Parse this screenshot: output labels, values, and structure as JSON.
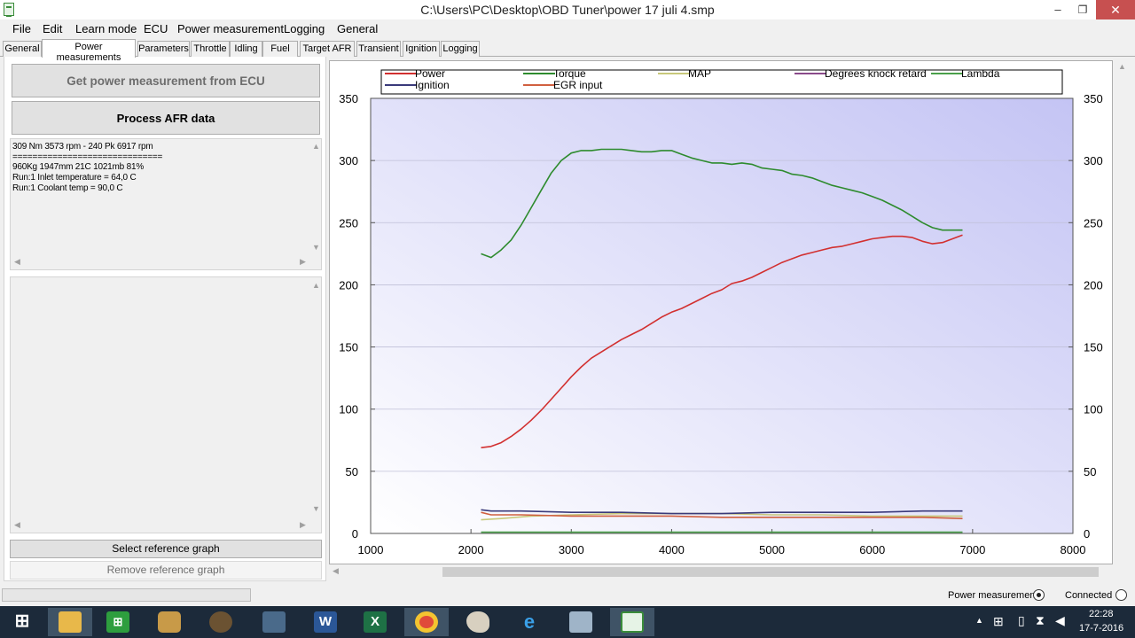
{
  "window": {
    "title": "C:\\Users\\PC\\Desktop\\OBD Tuner\\power 17 juli 4.smp",
    "minimize": "–",
    "maximize": "❐",
    "close": "✕"
  },
  "menu": [
    "File",
    "Edit",
    "Learn mode",
    "ECU",
    "Power measurement",
    "Logging",
    "General"
  ],
  "tabs": [
    "General",
    "Power measurements",
    "Parameters",
    "Throttle",
    "Idling",
    "Fuel",
    "Target AFR",
    "Transient",
    "Ignition",
    "Logging"
  ],
  "active_tab": "Power measurements",
  "left": {
    "get_button": "Get power measurement from ECU",
    "process_button": "Process AFR data",
    "info_lines": [
      "309 Nm 3573 rpm - 240 Pk 6917 rpm",
      "==============================",
      "960Kg 1947mm 21C 1021mb 81%",
      "Run:1 Inlet temperature = 64,0 C",
      "Run:1 Coolant temp = 90,0 C"
    ],
    "select_ref_button": "Select reference graph",
    "remove_ref_button": "Remove reference graph"
  },
  "chart_data": {
    "type": "line",
    "legend": [
      {
        "name": "Power",
        "color": "#d23030"
      },
      {
        "name": "Torque",
        "color": "#2e8b2e"
      },
      {
        "name": "MAP",
        "color": "#c8c87a"
      },
      {
        "name": "Degrees knock retard",
        "color": "#8a4a8a"
      },
      {
        "name": "Lambda",
        "color": "#4aa04a"
      },
      {
        "name": "Ignition",
        "color": "#3a3a7a"
      },
      {
        "name": "EGR input",
        "color": "#d06040"
      }
    ],
    "xlim": [
      1000,
      8000
    ],
    "ylim": [
      0,
      350
    ],
    "xticks": [
      "1000",
      "2000",
      "3000",
      "4000",
      "5000",
      "6000",
      "7000",
      "8000"
    ],
    "yticks": [
      "0",
      "50",
      "100",
      "150",
      "200",
      "250",
      "300",
      "350"
    ],
    "series": [
      {
        "name": "Power",
        "color": "#d23030",
        "x": [
          2100,
          2200,
          2300,
          2400,
          2500,
          2600,
          2700,
          2800,
          2900,
          3000,
          3100,
          3200,
          3300,
          3400,
          3500,
          3600,
          3700,
          3800,
          3900,
          4000,
          4100,
          4200,
          4300,
          4400,
          4500,
          4600,
          4700,
          4800,
          4900,
          5000,
          5100,
          5200,
          5300,
          5400,
          5500,
          5600,
          5700,
          5800,
          5900,
          6000,
          6100,
          6200,
          6300,
          6400,
          6500,
          6600,
          6700,
          6800,
          6900
        ],
        "y": [
          69,
          70,
          73,
          78,
          84,
          91,
          99,
          108,
          117,
          126,
          134,
          141,
          146,
          151,
          156,
          160,
          164,
          169,
          174,
          178,
          181,
          185,
          189,
          193,
          196,
          201,
          203,
          206,
          210,
          214,
          218,
          221,
          224,
          226,
          228,
          230,
          231,
          233,
          235,
          237,
          238,
          239,
          239,
          238,
          235,
          233,
          234,
          237,
          240
        ]
      },
      {
        "name": "Torque",
        "color": "#2e8b2e",
        "x": [
          2100,
          2200,
          2300,
          2400,
          2500,
          2600,
          2700,
          2800,
          2900,
          3000,
          3100,
          3200,
          3300,
          3400,
          3500,
          3600,
          3700,
          3800,
          3900,
          4000,
          4100,
          4200,
          4300,
          4400,
          4500,
          4600,
          4700,
          4800,
          4900,
          5000,
          5100,
          5200,
          5300,
          5400,
          5500,
          5600,
          5700,
          5800,
          5900,
          6000,
          6100,
          6200,
          6300,
          6400,
          6500,
          6600,
          6700,
          6800,
          6900
        ],
        "y": [
          225,
          222,
          228,
          236,
          248,
          262,
          276,
          290,
          300,
          306,
          308,
          308,
          309,
          309,
          309,
          308,
          307,
          307,
          308,
          308,
          305,
          302,
          300,
          298,
          298,
          297,
          298,
          297,
          294,
          293,
          292,
          289,
          288,
          286,
          283,
          280,
          278,
          276,
          274,
          271,
          268,
          264,
          260,
          255,
          250,
          246,
          244,
          244,
          244
        ]
      },
      {
        "name": "MAP",
        "color": "#c8c87a",
        "x": [
          2100,
          2300,
          2600,
          3000,
          3500,
          4000,
          4500,
          5000,
          5500,
          6000,
          6500,
          6900
        ],
        "y": [
          11,
          12,
          14,
          15,
          16,
          16,
          16,
          15,
          15,
          14,
          14,
          14
        ]
      },
      {
        "name": "Ignition",
        "color": "#3a3a7a",
        "x": [
          2100,
          2200,
          2500,
          3000,
          3500,
          4000,
          4500,
          5000,
          5500,
          6000,
          6500,
          6900
        ],
        "y": [
          19,
          18,
          18,
          17,
          17,
          16,
          16,
          17,
          17,
          17,
          18,
          18
        ]
      },
      {
        "name": "EGR input",
        "color": "#d06040",
        "x": [
          2100,
          2200,
          2500,
          3000,
          3500,
          4000,
          4500,
          5000,
          5500,
          6000,
          6500,
          6900
        ],
        "y": [
          17,
          15,
          15,
          14,
          14,
          14,
          13,
          13,
          13,
          13,
          13,
          12
        ]
      },
      {
        "name": "Lambda",
        "color": "#4aa04a",
        "x": [
          2100,
          3000,
          4000,
          5000,
          6000,
          6900
        ],
        "y": [
          1,
          1,
          1,
          1,
          1,
          1
        ]
      }
    ]
  },
  "status": {
    "power_measurement": "Power measurement",
    "connected": "Connected"
  },
  "taskbar": {
    "time": "22:28",
    "date": "17-7-2016",
    "apps": [
      "windows-start-icon",
      "file-explorer-icon",
      "store-icon",
      "photo-app-icon",
      "speaker-app-icon",
      "document-app-icon",
      "word-icon",
      "excel-icon",
      "chrome-icon",
      "paint-icon",
      "internet-explorer-icon",
      "calculator-icon",
      "obd-tuner-icon"
    ]
  }
}
